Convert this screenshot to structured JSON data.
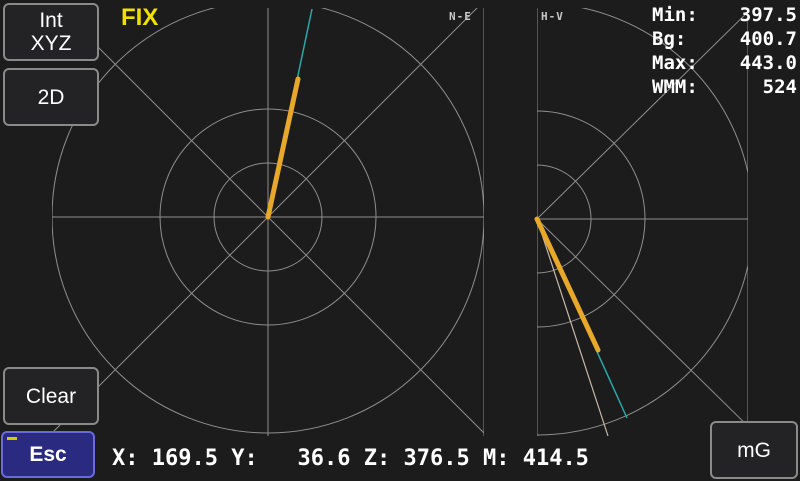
{
  "buttons": {
    "int_line1": "Int",
    "int_line2": "XYZ",
    "mode_2d": "2D",
    "clear": "Clear",
    "esc": "Esc",
    "unit": "mG"
  },
  "status": {
    "fix": "FIX"
  },
  "panels": {
    "ne_label": "N-E",
    "hv_label": "H-V"
  },
  "stats": {
    "min_label": "Min:",
    "min_value": "397.5",
    "bg_label": "Bg:",
    "bg_value": "400.7",
    "max_label": "Max:",
    "max_value": "443.0",
    "wmm_label": "WMM:",
    "wmm_value": "524"
  },
  "readout": {
    "x_label": "X:",
    "x_value": "169.5",
    "y_label": "Y:",
    "y_value": "36.6",
    "z_label": "Z:",
    "z_value": "376.5",
    "m_label": "M:",
    "m_value": "414.5"
  },
  "colors": {
    "background": "#1c1c1d",
    "grid": "#8e8e8e",
    "vector": "#e8a82a",
    "reference": "#2aa8a8",
    "fix": "#f0e000",
    "esc_button": "#2a2a80"
  },
  "icons": []
}
